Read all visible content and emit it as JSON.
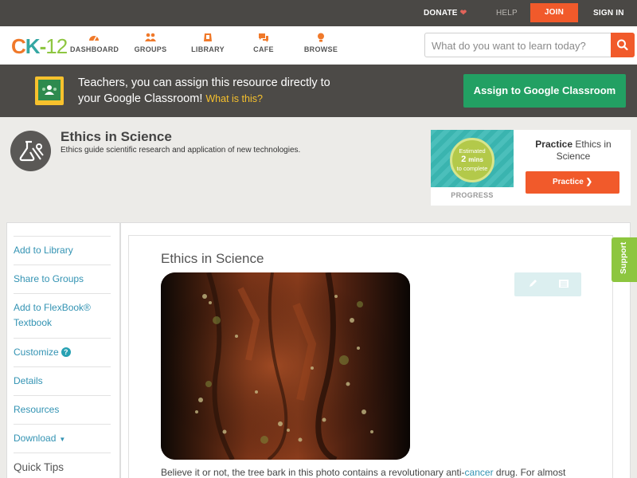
{
  "topbar": {
    "donate": "DONATE",
    "help": "HELP",
    "join": "JOIN",
    "signin": "SIGN IN"
  },
  "nav": {
    "logo": {
      "c": "C",
      "k": "K",
      "dash": "-",
      "num": "12"
    },
    "items": [
      {
        "label": "DASHBOARD",
        "icon": "dashboard-icon"
      },
      {
        "label": "GROUPS",
        "icon": "groups-icon"
      },
      {
        "label": "LIBRARY",
        "icon": "library-icon"
      },
      {
        "label": "CAFE",
        "icon": "cafe-icon"
      },
      {
        "label": "BROWSE",
        "icon": "browse-icon"
      }
    ],
    "search_placeholder": "What do you want to learn today?"
  },
  "banner": {
    "line1": "Teachers, you can assign this resource directly to",
    "line2": "your Google Classroom!",
    "what_link": "What is this?",
    "assign_button": "Assign to Google Classroom"
  },
  "concept": {
    "title": "Ethics in Science",
    "description": "Ethics guide scientific research and application of new technologies."
  },
  "practice": {
    "estimate_top": "Estimated",
    "estimate_value": "2",
    "estimate_unit": "mins",
    "estimate_bottom": "to complete",
    "progress_label": "PROGRESS",
    "heading_bold": "Practice",
    "heading_rest": " Ethics in Science",
    "button": "Practice"
  },
  "sidebar": {
    "items": [
      {
        "label": "Add to Library"
      },
      {
        "label": "Share to Groups"
      },
      {
        "label": "Add to FlexBook®",
        "label2": "Textbook"
      },
      {
        "label": "Customize"
      },
      {
        "label": "Details"
      },
      {
        "label": "Resources"
      },
      {
        "label": "Download"
      },
      {
        "label": "Quick Tips"
      }
    ]
  },
  "article": {
    "title": "Ethics in Science",
    "body_start": "Believe it or not, the tree bark in this photo contains a revolutionary anti-",
    "body_link": "cancer",
    "body_end": " drug. For almost"
  },
  "support_tab": "Support",
  "colors": {
    "accent_orange": "#f15a2b",
    "google_green": "#22a063",
    "link_blue": "#3393b3",
    "support_green": "#8dc63f"
  }
}
